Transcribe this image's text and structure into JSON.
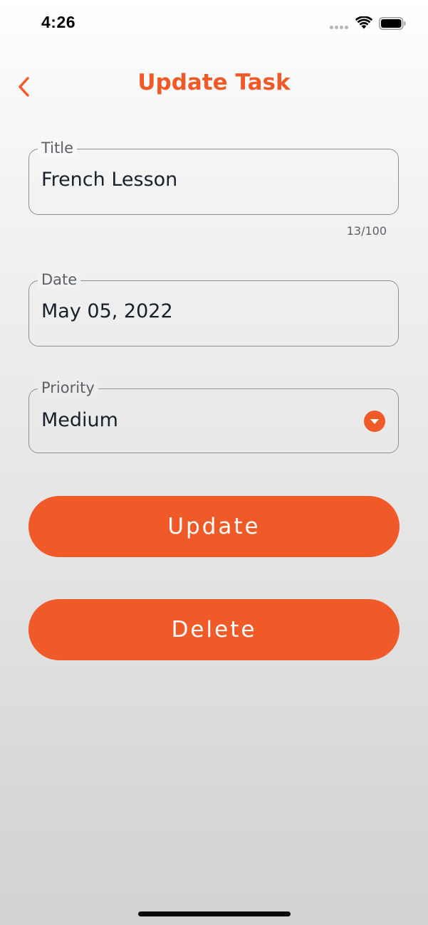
{
  "status_bar": {
    "time": "4:26",
    "icons": [
      "signal-dots-icon",
      "wifi-icon",
      "battery-icon"
    ]
  },
  "header": {
    "title": "Update Task",
    "back_icon": "chevron-left-icon"
  },
  "form": {
    "title_field": {
      "label": "Title",
      "value": "French Lesson",
      "counter": "13/100"
    },
    "date_field": {
      "label": "Date",
      "value": "May 05, 2022"
    },
    "priority_field": {
      "label": "Priority",
      "value": "Medium",
      "dropdown_icon": "caret-down-circle-icon"
    }
  },
  "buttons": {
    "update_label": "Update",
    "delete_label": "Delete"
  },
  "colors": {
    "accent": "#f05a28",
    "text": "#16212b",
    "label": "#5c6167",
    "border": "#8d9196"
  }
}
